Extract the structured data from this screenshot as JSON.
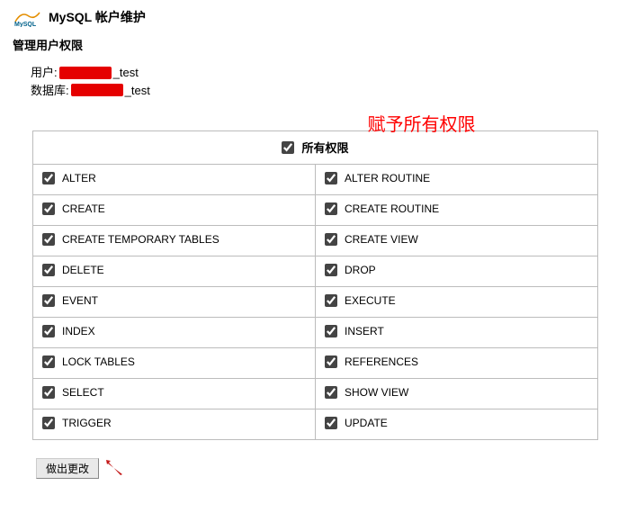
{
  "header": {
    "title": "MySQL 帐户维护",
    "logo_text": "MySQL"
  },
  "subtitle": "管理用户权限",
  "info": {
    "user_label": "用户:",
    "user_suffix": "_test",
    "db_label": "数据库:",
    "db_suffix": "_test"
  },
  "annotation": "赋予所有权限",
  "all_label": "所有权限",
  "privileges_left": [
    "ALTER",
    "CREATE",
    "CREATE TEMPORARY TABLES",
    "DELETE",
    "EVENT",
    "INDEX",
    "LOCK TABLES",
    "SELECT",
    "TRIGGER"
  ],
  "privileges_right": [
    "ALTER ROUTINE",
    "CREATE ROUTINE",
    "CREATE VIEW",
    "DROP",
    "EXECUTE",
    "INSERT",
    "REFERENCES",
    "SHOW VIEW",
    "UPDATE"
  ],
  "submit_label": "做出更改"
}
